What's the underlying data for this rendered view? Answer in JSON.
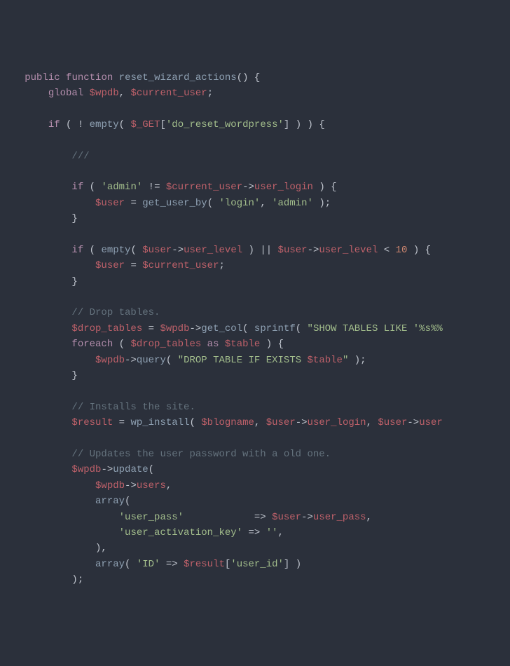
{
  "code": {
    "l1_indent": "   ",
    "l1_public": "public",
    "l1_function": "function",
    "l1_fname": "reset_wizard_actions",
    "l1_parens_brace": "() {",
    "l2_indent": "       ",
    "l2_global": "global",
    "l2_wpdb": "$wpdb",
    "l2_comma": ", ",
    "l2_current_user": "$current_user",
    "l2_semi": ";",
    "l3_blank": "",
    "l4_indent": "       ",
    "l4_if": "if",
    "l4_open": " ( ! ",
    "l4_empty": "empty",
    "l4_paren": "( ",
    "l4_get": "$_GET",
    "l4_bracket": "[",
    "l4_key": "'do_reset_wordpress'",
    "l4_close": "] ) ) {",
    "l5_blank": "",
    "l6_indent": "           ",
    "l6_cmt": "///",
    "l7_blank": "",
    "l8_indent": "           ",
    "l8_if": "if",
    "l8_open": " ( ",
    "l8_admin": "'admin'",
    "l8_neq": " != ",
    "l8_cuser": "$current_user",
    "l8_arrow": "->",
    "l8_ulogin": "user_login",
    "l8_close": " ) {",
    "l9_indent": "               ",
    "l9_user": "$user",
    "l9_eq": " = ",
    "l9_getby": "get_user_by",
    "l9_open": "( ",
    "l9_login": "'login'",
    "l9_comma": ", ",
    "l9_admin": "'admin'",
    "l9_close": " );",
    "l10_indent": "           ",
    "l10_brace": "}",
    "l11_blank": "",
    "l12_indent": "           ",
    "l12_if": "if",
    "l12_open": " ( ",
    "l12_empty": "empty",
    "l12_paren": "( ",
    "l12_user": "$user",
    "l12_arrow": "->",
    "l12_ulevel": "user_level",
    "l12_mid": " ) || ",
    "l12_user2": "$user",
    "l12_arrow2": "->",
    "l12_ulevel2": "user_level",
    "l12_lt": " < ",
    "l12_ten": "10",
    "l12_close": " ) {",
    "l13_indent": "               ",
    "l13_user": "$user",
    "l13_eq": " = ",
    "l13_cuser": "$current_user",
    "l13_semi": ";",
    "l14_indent": "           ",
    "l14_brace": "}",
    "l15_blank": "",
    "l16_indent": "           ",
    "l16_cmt": "// Drop tables.",
    "l17_indent": "           ",
    "l17_dt": "$drop_tables",
    "l17_eq": " = ",
    "l17_wpdb": "$wpdb",
    "l17_arrow": "->",
    "l17_getcol": "get_col",
    "l17_open": "( ",
    "l17_sprintf": "sprintf",
    "l17_paren": "( ",
    "l17_sql": "\"SHOW TABLES LIKE '%s%%",
    "l18_indent": "           ",
    "l18_foreach": "foreach",
    "l18_open": " ( ",
    "l18_dt": "$drop_tables",
    "l18_as": " as ",
    "l18_table": "$table",
    "l18_close": " ) {",
    "l19_indent": "               ",
    "l19_wpdb": "$wpdb",
    "l19_arrow": "->",
    "l19_query": "query",
    "l19_open": "( ",
    "l19_sql1": "\"DROP TABLE IF EXISTS ",
    "l19_table": "$table",
    "l19_sql2": "\"",
    "l19_close": " );",
    "l20_indent": "           ",
    "l20_brace": "}",
    "l21_blank": "",
    "l22_indent": "           ",
    "l22_cmt": "// Installs the site.",
    "l23_indent": "           ",
    "l23_result": "$result",
    "l23_eq": " = ",
    "l23_wpinstall": "wp_install",
    "l23_open": "( ",
    "l23_blogname": "$blogname",
    "l23_comma": ", ",
    "l23_user": "$user",
    "l23_arrow": "->",
    "l23_ulogin": "user_login",
    "l23_comma2": ", ",
    "l23_user2": "$user",
    "l23_arrow2": "->",
    "l23_usert": "user",
    "l24_blank": "",
    "l25_indent": "           ",
    "l25_cmt": "// Updates the user password with a old one.",
    "l26_indent": "           ",
    "l26_wpdb": "$wpdb",
    "l26_arrow": "->",
    "l26_update": "update",
    "l26_open": "(",
    "l27_indent": "               ",
    "l27_wpdb": "$wpdb",
    "l27_arrow": "->",
    "l27_users": "users",
    "l27_comma": ",",
    "l28_indent": "               ",
    "l28_array": "array",
    "l28_open": "(",
    "l29_indent": "                   ",
    "l29_key": "'user_pass'",
    "l29_pad": "           ",
    "l29_arrow": " => ",
    "l29_user": "$user",
    "l29_objarrow": "->",
    "l29_upass": "user_pass",
    "l29_comma": ",",
    "l30_indent": "                   ",
    "l30_key": "'user_activation_key'",
    "l30_arrow": " => ",
    "l30_val": "''",
    "l30_comma": ",",
    "l31_indent": "               ",
    "l31_close": "),",
    "l32_indent": "               ",
    "l32_array": "array",
    "l32_open": "( ",
    "l32_id": "'ID'",
    "l32_arrow": " => ",
    "l32_result": "$result",
    "l32_bracket": "[",
    "l32_uid": "'user_id'",
    "l32_close": "] )",
    "l33_indent": "           ",
    "l33_close": ");"
  }
}
